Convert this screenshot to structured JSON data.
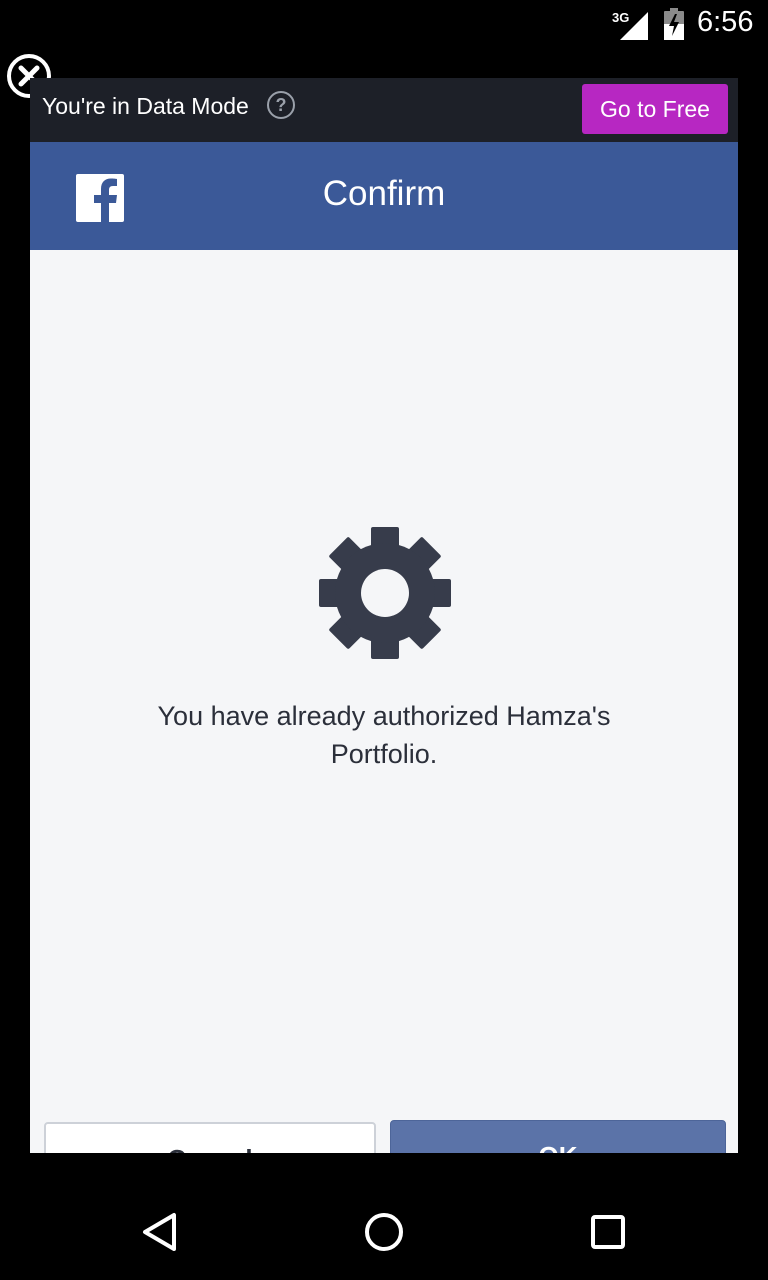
{
  "status_bar": {
    "network": "3G",
    "time": "6:56"
  },
  "data_mode_bar": {
    "text": "You're in Data Mode",
    "go_free_label": "Go to Free",
    "accent_color": "#b727c2"
  },
  "header": {
    "title": "Confirm",
    "brand_color": "#3b5998"
  },
  "main": {
    "message": "You have already authorized Hamza's Portfolio.",
    "cancel_label": "Cancel",
    "ok_label": "OK"
  },
  "icons": [
    "close-icon",
    "help-icon",
    "facebook-logo-icon",
    "gear-icon",
    "back-icon",
    "home-icon",
    "recent-apps-icon"
  ]
}
